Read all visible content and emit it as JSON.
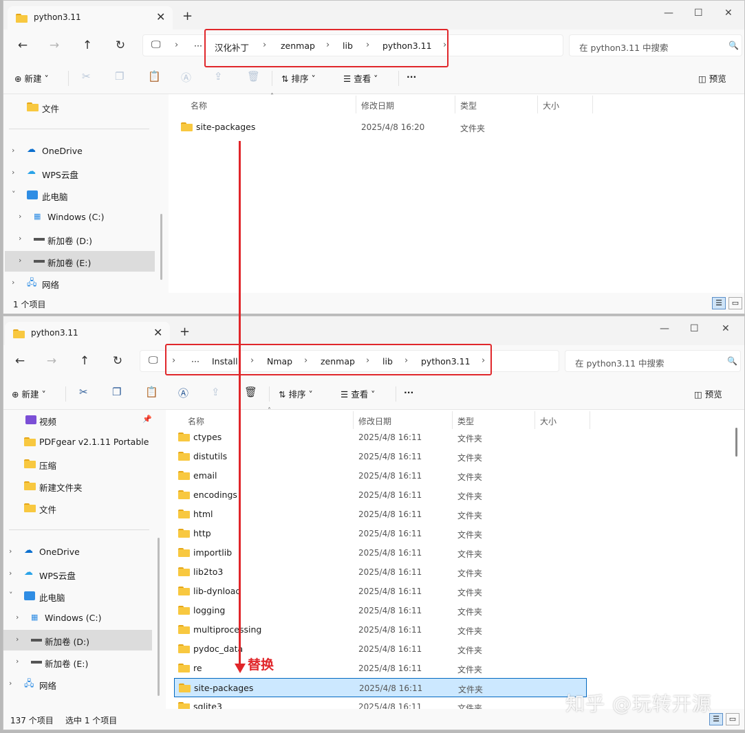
{
  "w1": {
    "tab_title": "python3.11",
    "breadcrumb": [
      "汉化补丁",
      "zenmap",
      "lib",
      "python3.11"
    ],
    "search_placeholder": "在 python3.11 中搜索",
    "toolbar": {
      "new": "新建",
      "sort": "排序",
      "view": "查看",
      "more": "···",
      "preview": "预览"
    },
    "sidebar": [
      {
        "label": "文件",
        "icon": "folder-icon"
      },
      {
        "label": "OneDrive",
        "icon": "cloud-icon"
      },
      {
        "label": "WPS云盘",
        "icon": "cloud-icon"
      },
      {
        "label": "此电脑",
        "icon": "computer-icon"
      },
      {
        "label": "Windows (C:)",
        "icon": "windows-drive-icon"
      },
      {
        "label": "新加卷 (D:)",
        "icon": "drive-icon"
      },
      {
        "label": "新加卷 (E:)",
        "icon": "drive-icon"
      },
      {
        "label": "网络",
        "icon": "network-icon"
      }
    ],
    "columns": {
      "name": "名称",
      "modified": "修改日期",
      "type": "类型",
      "size": "大小"
    },
    "files": [
      {
        "name": "site-packages",
        "modified": "2025/4/8 16:20",
        "type": "文件夹"
      }
    ],
    "status": "1 个项目"
  },
  "w2": {
    "tab_title": "python3.11",
    "breadcrumb": [
      "Install",
      "Nmap",
      "zenmap",
      "lib",
      "python3.11"
    ],
    "search_placeholder": "在 python3.11 中搜索",
    "toolbar": {
      "new": "新建",
      "sort": "排序",
      "view": "查看",
      "more": "···",
      "preview": "预览"
    },
    "sidebar": [
      {
        "label": "视频",
        "icon": "video-icon"
      },
      {
        "label": "PDFgear v2.1.11 Portable",
        "icon": "folder-icon"
      },
      {
        "label": "压缩",
        "icon": "folder-icon"
      },
      {
        "label": "新建文件夹",
        "icon": "folder-icon"
      },
      {
        "label": "文件",
        "icon": "folder-icon"
      },
      {
        "label": "OneDrive",
        "icon": "cloud-icon"
      },
      {
        "label": "WPS云盘",
        "icon": "cloud-icon"
      },
      {
        "label": "此电脑",
        "icon": "computer-icon"
      },
      {
        "label": "Windows (C:)",
        "icon": "windows-drive-icon"
      },
      {
        "label": "新加卷 (D:)",
        "icon": "drive-icon"
      },
      {
        "label": "新加卷 (E:)",
        "icon": "drive-icon"
      },
      {
        "label": "网络",
        "icon": "network-icon"
      }
    ],
    "columns": {
      "name": "名称",
      "modified": "修改日期",
      "type": "类型",
      "size": "大小"
    },
    "files": [
      {
        "name": "ctypes",
        "modified": "2025/4/8 16:11",
        "type": "文件夹"
      },
      {
        "name": "distutils",
        "modified": "2025/4/8 16:11",
        "type": "文件夹"
      },
      {
        "name": "email",
        "modified": "2025/4/8 16:11",
        "type": "文件夹"
      },
      {
        "name": "encodings",
        "modified": "2025/4/8 16:11",
        "type": "文件夹"
      },
      {
        "name": "html",
        "modified": "2025/4/8 16:11",
        "type": "文件夹"
      },
      {
        "name": "http",
        "modified": "2025/4/8 16:11",
        "type": "文件夹"
      },
      {
        "name": "importlib",
        "modified": "2025/4/8 16:11",
        "type": "文件夹"
      },
      {
        "name": "lib2to3",
        "modified": "2025/4/8 16:11",
        "type": "文件夹"
      },
      {
        "name": "lib-dynload",
        "modified": "2025/4/8 16:11",
        "type": "文件夹"
      },
      {
        "name": "logging",
        "modified": "2025/4/8 16:11",
        "type": "文件夹"
      },
      {
        "name": "multiprocessing",
        "modified": "2025/4/8 16:11",
        "type": "文件夹"
      },
      {
        "name": "pydoc_data",
        "modified": "2025/4/8 16:11",
        "type": "文件夹"
      },
      {
        "name": "re",
        "modified": "2025/4/8 16:11",
        "type": "文件夹"
      },
      {
        "name": "site-packages",
        "modified": "2025/4/8 16:11",
        "type": "文件夹"
      },
      {
        "name": "sqlite3",
        "modified": "2025/4/8 16:11",
        "type": "文件夹"
      }
    ],
    "status_count": "137 个项目",
    "status_selected": "选中 1 个项目"
  },
  "annotation": "替换",
  "watermark": "知乎 @玩转开源",
  "colors": {
    "highlight": "#e0262a",
    "selection": "#cce8ff",
    "folder": "#f8c840"
  }
}
